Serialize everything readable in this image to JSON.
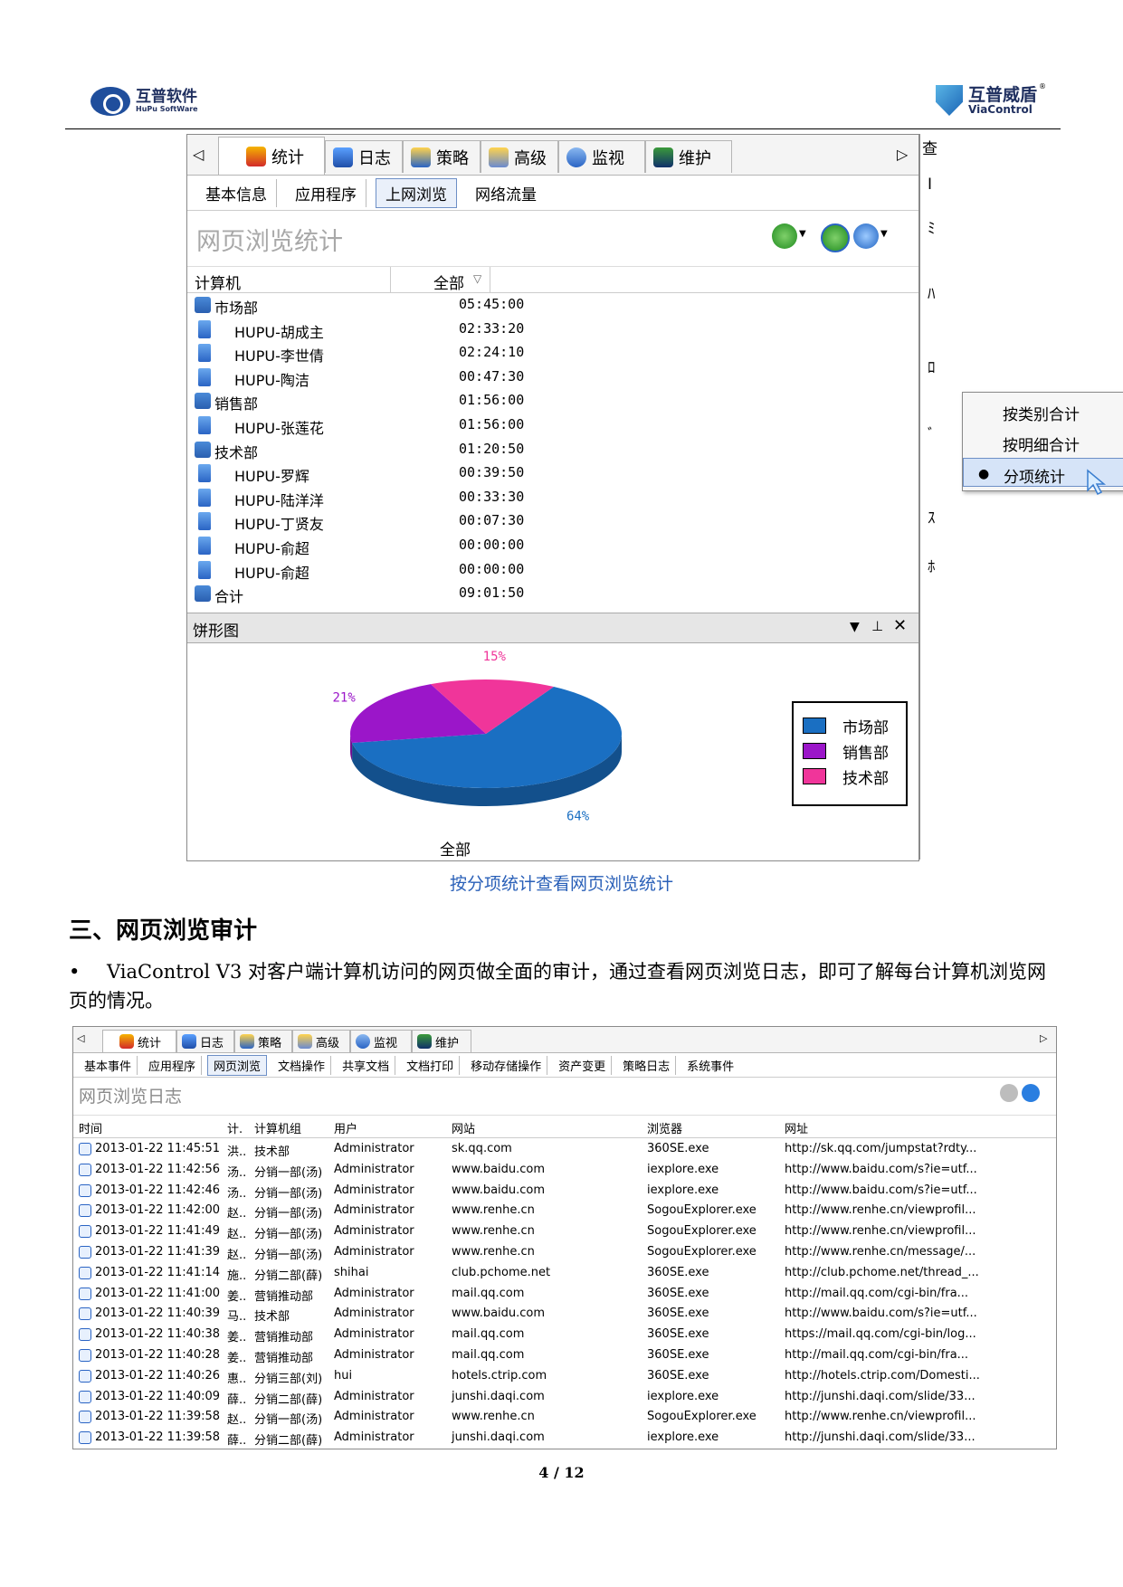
{
  "header": {
    "left_logo_cn": "互普软件",
    "left_logo_en": "HuPu SoftWare",
    "right_logo_cn": "互普威盾",
    "right_logo_en": "ViaControl",
    "right_logo_reg": "®"
  },
  "shot1": {
    "tabs": [
      "统计",
      "日志",
      "策略",
      "高级",
      "监视",
      "维护"
    ],
    "subtabs": [
      "基本信息",
      "应用程序",
      "上网浏览",
      "网络流量"
    ],
    "selected_subtab": "上网浏览",
    "title": "网页浏览统计",
    "col_computer": "计算机",
    "col_all": "全部",
    "rows": [
      {
        "name": "市场部",
        "value": "05:45:00",
        "type": "group"
      },
      {
        "name": "HUPU-胡成主",
        "value": "02:33:20",
        "type": "pc"
      },
      {
        "name": "HUPU-李世倩",
        "value": "02:24:10",
        "type": "pc"
      },
      {
        "name": "HUPU-陶洁",
        "value": "00:47:30",
        "type": "pc"
      },
      {
        "name": "销售部",
        "value": "01:56:00",
        "type": "group"
      },
      {
        "name": "HUPU-张莲花",
        "value": "01:56:00",
        "type": "pc"
      },
      {
        "name": "技术部",
        "value": "01:20:50",
        "type": "group"
      },
      {
        "name": "HUPU-罗辉",
        "value": "00:39:50",
        "type": "pc"
      },
      {
        "name": "HUPU-陆洋洋",
        "value": "00:33:30",
        "type": "pc"
      },
      {
        "name": "HUPU-丁贤友",
        "value": "00:07:30",
        "type": "pc"
      },
      {
        "name": "HUPU-俞超",
        "value": "00:00:00",
        "type": "pc"
      },
      {
        "name": "HUPU-俞超",
        "value": "00:00:00",
        "type": "pc"
      },
      {
        "name": "合计",
        "value": "09:01:50",
        "type": "group"
      }
    ],
    "menu": [
      "按类别合计",
      "按明细合计",
      "分项统计"
    ],
    "menu_selected": "分项统计",
    "pane_title": "饼形图",
    "side_chars": [
      "查",
      "I",
      "ﾐ",
      "ﾊ",
      "ﾛ",
      "ﾞ",
      "ｽ",
      "ﾎ"
    ]
  },
  "chart_data": {
    "type": "pie",
    "categories": [
      "市场部",
      "销售部",
      "技术部"
    ],
    "values": [
      64,
      21,
      15
    ],
    "value_labels": [
      "64%",
      "21%",
      "15%"
    ],
    "colors": [
      "#1a6fc2",
      "#9b16c9",
      "#f0359a"
    ],
    "xlabel": "全部",
    "legend": "right"
  },
  "caption": "按分项统计查看网页浏览统计",
  "section_heading": "三、网页浏览审计",
  "paragraph": "ViaControl V3 对客户端计算机访问的网页做全面的审计，通过查看网页浏览日志，即可了解每台计算机浏览网页的情况。",
  "bullet": "•",
  "shot2": {
    "tabs": [
      "统计",
      "日志",
      "策略",
      "高级",
      "监视",
      "维护"
    ],
    "subtabs": [
      "基本事件",
      "应用程序",
      "网页浏览",
      "文档操作",
      "共享文档",
      "文档打印",
      "移动存储操作",
      "资产变更",
      "策略日志",
      "系统事件"
    ],
    "selected_subtab": "网页浏览",
    "title": "网页浏览日志",
    "columns": [
      "时间",
      "计.",
      "计算机组",
      "用户",
      "网站",
      "浏览器",
      "网址"
    ],
    "rows": [
      [
        "2013-01-22 11:45:51",
        "洪..",
        "技术部",
        "Administrator",
        "sk.qq.com",
        "360SE.exe",
        "http://sk.qq.com/jumpstat?rdty..."
      ],
      [
        "2013-01-22 11:42:56",
        "汤..",
        "分销一部(汤)",
        "Administrator",
        "www.baidu.com",
        "iexplore.exe",
        "http://www.baidu.com/s?ie=utf..."
      ],
      [
        "2013-01-22 11:42:46",
        "汤..",
        "分销一部(汤)",
        "Administrator",
        "www.baidu.com",
        "iexplore.exe",
        "http://www.baidu.com/s?ie=utf..."
      ],
      [
        "2013-01-22 11:42:00",
        "赵..",
        "分销一部(汤)",
        "Administrator",
        "www.renhe.cn",
        "SogouExplorer.exe",
        "http://www.renhe.cn/viewprofil..."
      ],
      [
        "2013-01-22 11:41:49",
        "赵..",
        "分销一部(汤)",
        "Administrator",
        "www.renhe.cn",
        "SogouExplorer.exe",
        "http://www.renhe.cn/viewprofil..."
      ],
      [
        "2013-01-22 11:41:39",
        "赵..",
        "分销一部(汤)",
        "Administrator",
        "www.renhe.cn",
        "SogouExplorer.exe",
        "http://www.renhe.cn/message/..."
      ],
      [
        "2013-01-22 11:41:14",
        "施..",
        "分销二部(薛)",
        "shihai",
        "club.pchome.net",
        "360SE.exe",
        "http://club.pchome.net/thread_..."
      ],
      [
        "2013-01-22 11:41:00",
        "姜..",
        "营销推动部",
        "Administrator",
        "mail.qq.com",
        "360SE.exe",
        "http://mail.qq.com/cgi-bin/fra..."
      ],
      [
        "2013-01-22 11:40:39",
        "马..",
        "技术部",
        "Administrator",
        "www.baidu.com",
        "360SE.exe",
        "http://www.baidu.com/s?ie=utf..."
      ],
      [
        "2013-01-22 11:40:38",
        "姜..",
        "营销推动部",
        "Administrator",
        "mail.qq.com",
        "360SE.exe",
        "https://mail.qq.com/cgi-bin/log..."
      ],
      [
        "2013-01-22 11:40:28",
        "姜..",
        "营销推动部",
        "Administrator",
        "mail.qq.com",
        "360SE.exe",
        "http://mail.qq.com/cgi-bin/fra..."
      ],
      [
        "2013-01-22 11:40:26",
        "惠..",
        "分销三部(刘)",
        "hui",
        "hotels.ctrip.com",
        "360SE.exe",
        "http://hotels.ctrip.com/Domesti..."
      ],
      [
        "2013-01-22 11:40:09",
        "薛..",
        "分销二部(薛)",
        "Administrator",
        "junshi.daqi.com",
        "iexplore.exe",
        "http://junshi.daqi.com/slide/33..."
      ],
      [
        "2013-01-22 11:39:58",
        "赵..",
        "分销一部(汤)",
        "Administrator",
        "www.renhe.cn",
        "SogouExplorer.exe",
        "http://www.renhe.cn/viewprofil..."
      ],
      [
        "2013-01-22 11:39:58",
        "薛..",
        "分销二部(薛)",
        "Administrator",
        "junshi.daqi.com",
        "iexplore.exe",
        "http://junshi.daqi.com/slide/33..."
      ]
    ]
  },
  "page_number": "4 / 12"
}
